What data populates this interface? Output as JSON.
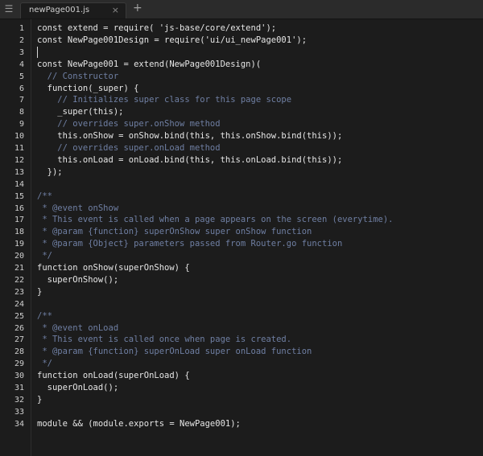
{
  "tab": {
    "menu_icon": "list-icon",
    "title": "newPage001.js",
    "close_glyph": "×",
    "new_tab_glyph": "+"
  },
  "editor": {
    "lines": [
      {
        "n": "1",
        "code": "const extend = require( 'js-base/core/extend');"
      },
      {
        "n": "2",
        "code": "const NewPage001Design = require('ui/ui_newPage001');"
      },
      {
        "n": "3",
        "code": ""
      },
      {
        "n": "4",
        "code": "const NewPage001 = extend(NewPage001Design)("
      },
      {
        "n": "5",
        "code": "  // Constructor"
      },
      {
        "n": "6",
        "code": "  function(_super) {"
      },
      {
        "n": "7",
        "code": "    // Initializes super class for this page scope"
      },
      {
        "n": "8",
        "code": "    _super(this);"
      },
      {
        "n": "9",
        "code": "    // overrides super.onShow method"
      },
      {
        "n": "10",
        "code": "    this.onShow = onShow.bind(this, this.onShow.bind(this));"
      },
      {
        "n": "11",
        "code": "    // overrides super.onLoad method"
      },
      {
        "n": "12",
        "code": "    this.onLoad = onLoad.bind(this, this.onLoad.bind(this));"
      },
      {
        "n": "13",
        "code": "  });"
      },
      {
        "n": "14",
        "code": ""
      },
      {
        "n": "15",
        "code": "/**"
      },
      {
        "n": "16",
        "code": " * @event onShow"
      },
      {
        "n": "17",
        "code": " * This event is called when a page appears on the screen (everytime)."
      },
      {
        "n": "18",
        "code": " * @param {function} superOnShow super onShow function"
      },
      {
        "n": "19",
        "code": " * @param {Object} parameters passed from Router.go function"
      },
      {
        "n": "20",
        "code": " */"
      },
      {
        "n": "21",
        "code": "function onShow(superOnShow) {"
      },
      {
        "n": "22",
        "code": "  superOnShow();"
      },
      {
        "n": "23",
        "code": "}"
      },
      {
        "n": "24",
        "code": ""
      },
      {
        "n": "25",
        "code": "/**"
      },
      {
        "n": "26",
        "code": " * @event onLoad"
      },
      {
        "n": "27",
        "code": " * This event is called once when page is created."
      },
      {
        "n": "28",
        "code": " * @param {function} superOnLoad super onLoad function"
      },
      {
        "n": "29",
        "code": " */"
      },
      {
        "n": "30",
        "code": "function onLoad(superOnLoad) {"
      },
      {
        "n": "31",
        "code": "  superOnLoad();"
      },
      {
        "n": "32",
        "code": "}"
      },
      {
        "n": "33",
        "code": ""
      },
      {
        "n": "34",
        "code": "module && (module.exports = NewPage001);"
      }
    ]
  }
}
